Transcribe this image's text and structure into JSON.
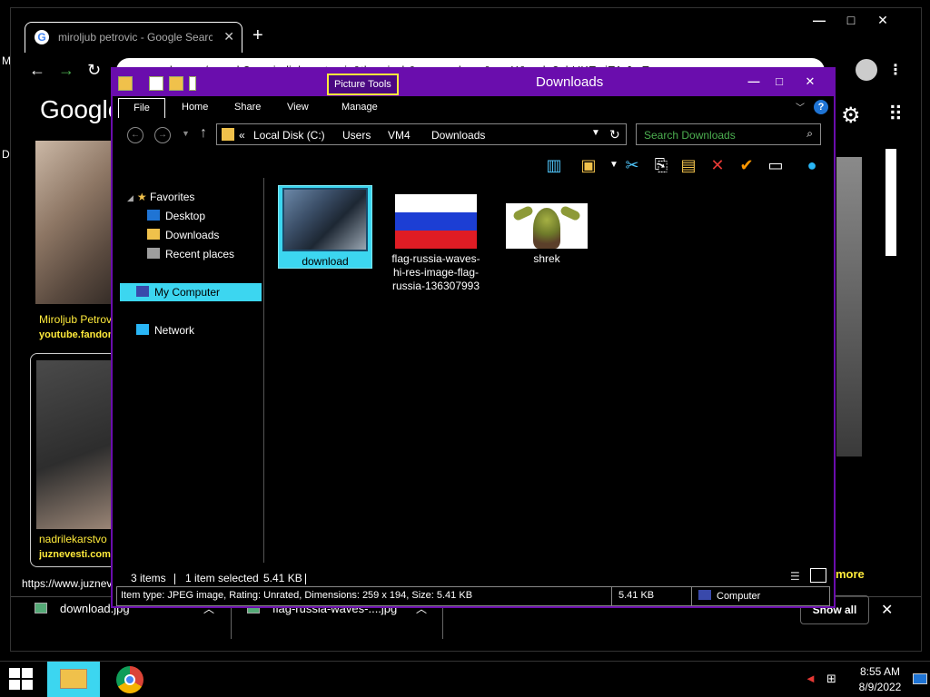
{
  "chrome": {
    "tab_title": "miroljub petrovic - Google Search",
    "tab_close": "✕",
    "new_tab": "+",
    "omnibox_text": "google.com/search?q=miroljub+petrovic&tbm=isch&source=lnms&sa=X&ved=2ahUKEwiE1rJmEmEAhW",
    "google_logo": "Google",
    "result1_title": "Miroljub Petrovic",
    "result1_source": "youtube.fandom.com",
    "result2_title": "nadrilekarstvo",
    "result2_source": "juznevesti.com",
    "more_link": "more",
    "hover_url": "https://www.juznevesti.com",
    "window_controls": {
      "minimize": "—",
      "maximize": "□",
      "close": "✕"
    }
  },
  "downloads_bar": {
    "items": [
      {
        "label": "download.jpg"
      },
      {
        "label": "flag-russia-waves-....jpg"
      }
    ],
    "show_all": "Show all",
    "close": "✕"
  },
  "explorer": {
    "title": "Downloads",
    "contextual_tab": "Picture Tools",
    "ribbon_tabs": {
      "file": "File",
      "home": "Home",
      "share": "Share",
      "view": "View",
      "manage": "Manage"
    },
    "help": "?",
    "breadcrumbs": {
      "prefix": "«",
      "c1": "Local Disk (C:)",
      "c2": "Users",
      "c3": "VM4",
      "c4": "Downloads"
    },
    "search_placeholder": "Search Downloads",
    "nav": {
      "favorites": "Favorites",
      "desktop": "Desktop",
      "downloads": "Downloads",
      "recent": "Recent places",
      "my_computer": "My Computer",
      "network": "Network"
    },
    "files": [
      {
        "name": "download",
        "selected": true
      },
      {
        "name": "flag-russia-waves-hi-res-image-flag-russia-136307993"
      },
      {
        "name": "shrek"
      }
    ],
    "status": {
      "count": "3 items",
      "selected": "1 item selected",
      "size": "5.41 KB"
    },
    "details": {
      "info": "Item type: JPEG image, Rating: Unrated, Dimensions: 259 x 194, Size: 5.41 KB",
      "size": "5.41 KB",
      "location": "Computer"
    },
    "window_controls": {
      "minimize": "—",
      "maximize": "□",
      "close": "✕"
    }
  },
  "taskbar": {
    "time": "8:55 AM",
    "date": "8/9/2022"
  },
  "colors": {
    "explorer_accent": "#6a0dad",
    "selection": "#3cd6f0",
    "link_yellow": "#ffeb3b",
    "search_placeholder_green": "#4caf50"
  }
}
